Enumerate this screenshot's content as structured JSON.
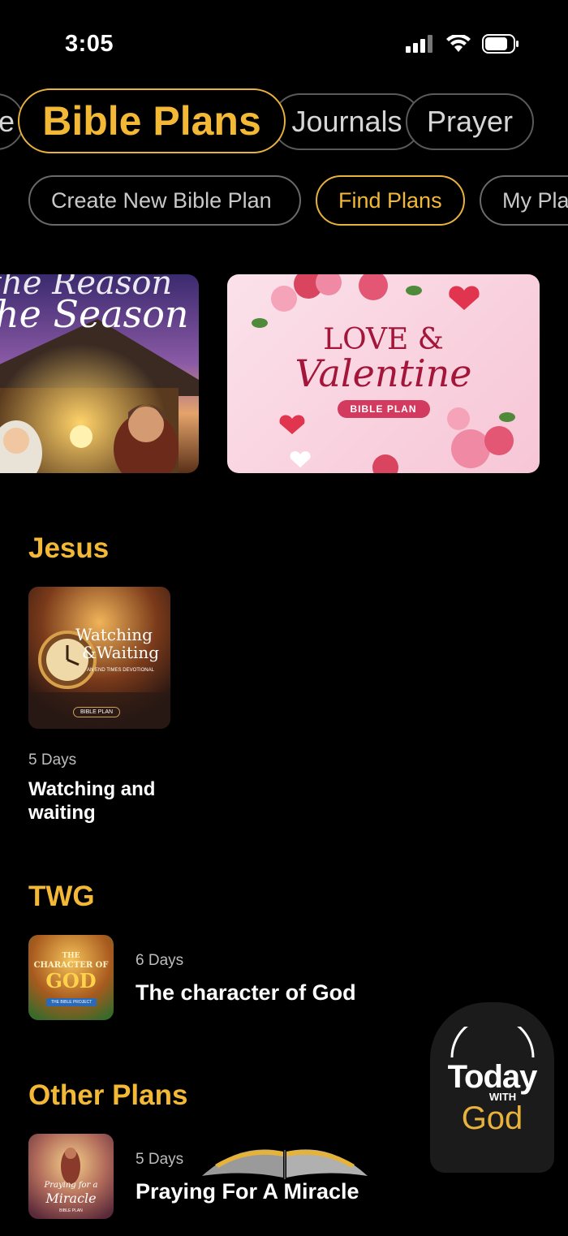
{
  "status": {
    "time": "3:05"
  },
  "tabs": [
    {
      "label": "e"
    },
    {
      "label": "Bible Plans"
    },
    {
      "label": "Journals"
    },
    {
      "label": "Prayer"
    }
  ],
  "subtabs": [
    {
      "label": "Create New Bible Plan"
    },
    {
      "label": "Find Plans"
    },
    {
      "label": "My Pla"
    }
  ],
  "banners": [
    {
      "title_line1": "the Reason",
      "title_line2": "he Season"
    },
    {
      "title_line1": "LOVE &",
      "title_line2": "Valentine",
      "tag": "BIBLE PLAN"
    }
  ],
  "sections": [
    {
      "title": "Jesus",
      "plans": [
        {
          "days": "5 Days",
          "title_line1": "Watching and",
          "title_line2": "waiting",
          "thumb_text1": "Watching",
          "thumb_text2": "&Waiting",
          "thumb_sub": "AN END TIMES DEVOTIONAL",
          "thumb_tag": "BIBLE PLAN"
        }
      ]
    },
    {
      "title": "TWG",
      "plans": [
        {
          "days": "6 Days",
          "title": "The character of God",
          "thumb_text1": "THE",
          "thumb_text2": "CHARACTER OF",
          "thumb_text3": "GOD",
          "thumb_tag": "THE BIBLE PROJECT"
        }
      ]
    },
    {
      "title": "Other Plans",
      "plans": [
        {
          "days": "5 Days",
          "title": "Praying For A Miracle",
          "thumb_text1": "Praying for a",
          "thumb_text2": "Miracle",
          "thumb_tag": "BIBLE PLAN"
        }
      ]
    }
  ],
  "logo": {
    "line1": "Today",
    "line2": "WITH",
    "line3": "God"
  },
  "colors": {
    "accent": "#f2b836",
    "background": "#000000"
  }
}
